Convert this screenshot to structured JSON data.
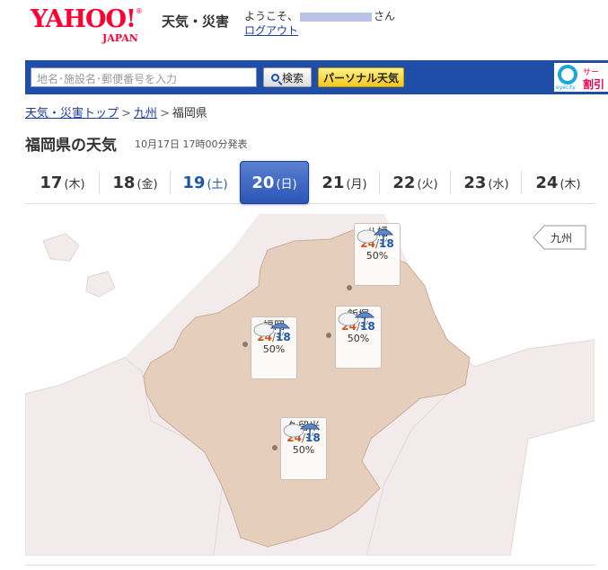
{
  "header": {
    "logo_text": "YAHOO!",
    "logo_sub": "JAPAN",
    "service_name": "天気・災害",
    "welcome_prefix": "ようこそ、",
    "welcome_suffix": "さん",
    "logout_label": "ログアウト"
  },
  "search": {
    "placeholder": "地名･施設名･郵便番号を入力",
    "search_label": "検索",
    "personal_label": "パーソナル天気",
    "ad_brand": "eyecity",
    "ad_line1": "サー",
    "ad_line2": "割引"
  },
  "breadcrumb": {
    "items": [
      "天気・災害トップ",
      "九州",
      "福岡県"
    ],
    "separator": ">"
  },
  "title": {
    "heading": "福岡県の天気",
    "announced": "10月17日 17時00分発表"
  },
  "date_tabs": [
    {
      "day": "17",
      "weekday": "(木)",
      "kind": "weekday",
      "active": false
    },
    {
      "day": "18",
      "weekday": "(金)",
      "kind": "weekday",
      "active": false
    },
    {
      "day": "19",
      "weekday": "(土)",
      "kind": "sat",
      "active": false
    },
    {
      "day": "20",
      "weekday": "(日)",
      "kind": "sun",
      "active": true
    },
    {
      "day": "21",
      "weekday": "(月)",
      "kind": "weekday",
      "active": false
    },
    {
      "day": "22",
      "weekday": "(火)",
      "kind": "weekday",
      "active": false
    },
    {
      "day": "23",
      "weekday": "(水)",
      "kind": "weekday",
      "active": false
    },
    {
      "day": "24",
      "weekday": "(木)",
      "kind": "weekday",
      "active": false
    }
  ],
  "map": {
    "region_link": "九州",
    "cities": [
      {
        "name": "八幡",
        "high": "24",
        "low": "18",
        "pop": "50%",
        "icon": "cloudy-rain-icon"
      },
      {
        "name": "福岡",
        "high": "24",
        "low": "18",
        "pop": "50%",
        "icon": "cloudy-rain-icon"
      },
      {
        "name": "飯塚",
        "high": "24",
        "low": "18",
        "pop": "50%",
        "icon": "cloudy-rain-icon"
      },
      {
        "name": "久留米",
        "high": "24",
        "low": "18",
        "pop": "50%",
        "icon": "cloudy-rain-icon"
      }
    ]
  },
  "colors": {
    "brand_red": "#ff0033",
    "search_bar": "#1e4ea8",
    "active_tab": "#2a56b8",
    "saturday": "#1e56a8",
    "high_temp": "#d1521a",
    "low_temp": "#1e56a8",
    "prefecture_fill": "#e6cebc"
  }
}
